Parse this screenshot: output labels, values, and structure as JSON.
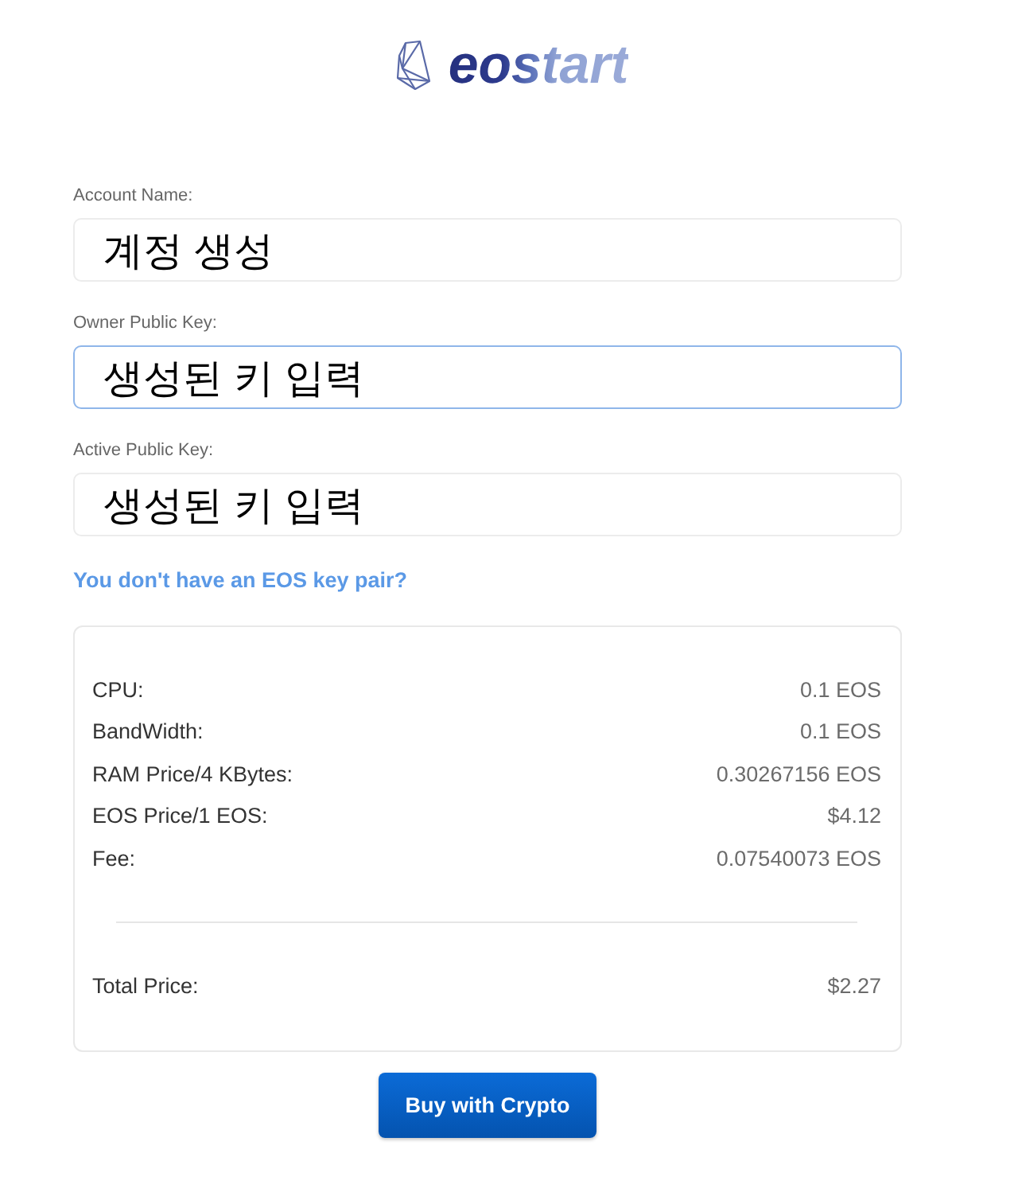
{
  "logo": {
    "text": "eostart"
  },
  "fields": [
    {
      "label": "Account Name:",
      "value": "계정 생성",
      "focused": false
    },
    {
      "label": "Owner Public Key:",
      "value": "생성된 키 입력",
      "focused": true
    },
    {
      "label": "Active Public Key:",
      "value": "생성된 키 입력",
      "focused": false
    }
  ],
  "key_pair_link": "You don't have an EOS key pair?",
  "summary": {
    "rows": [
      {
        "label": "CPU:",
        "value": "0.1 EOS"
      },
      {
        "label": "BandWidth:",
        "value": "0.1 EOS"
      },
      {
        "label": "RAM Price/4 KBytes:",
        "value": "0.30267156 EOS"
      },
      {
        "label": "EOS Price/1 EOS:",
        "value": "$4.12"
      },
      {
        "label": "Fee:",
        "value": "0.07540073 EOS"
      }
    ],
    "total": {
      "label": "Total Price:",
      "value": "$2.27"
    }
  },
  "buy_button": "Buy with Crypto"
}
